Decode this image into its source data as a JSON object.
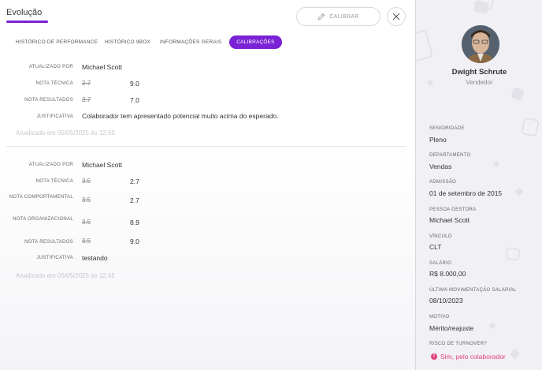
{
  "header": {
    "title": "Evolução",
    "calibrar_label": "CALIBRAR"
  },
  "tabs": [
    {
      "label": "HISTÓRICO DE PERFORMANCE",
      "active": false
    },
    {
      "label": "HISTÓRICO 9BOX",
      "active": false
    },
    {
      "label": "INFORMAÇÕES GERAIS",
      "active": false
    },
    {
      "label": "CALIBRAÇÕES",
      "active": true
    }
  ],
  "calibrations": [
    {
      "updated_by_label": "ATUALIZADO POR",
      "updated_by": "Michael Scott",
      "grades": [
        {
          "label": "NOTA TÉCNICA",
          "old": "2.7",
          "new": "9.0"
        },
        {
          "label": "NOTA RESULTADOS",
          "old": "2.7",
          "new": "7.0"
        }
      ],
      "justification_label": "JUSTIFICATIVA",
      "justification": "Colaborador tem apresentado potencial muito acima do esperado.",
      "updated_at": "Atualizado em 05/05/2025 às 12:50"
    },
    {
      "updated_by_label": "ATUALIZADO POR",
      "updated_by": "Michael Scott",
      "grades": [
        {
          "label": "NOTA TÉCNICA",
          "old": "3.5",
          "new": "2.7"
        },
        {
          "label": "NOTA COMPORTAMENTAL",
          "old": "3.5",
          "new": "2.7"
        },
        {
          "label": "NOTA ORGANIZACIONAL",
          "old": "3.5",
          "new": "8.9"
        },
        {
          "label": "NOTA RESULTADOS",
          "old": "3.5",
          "new": "9.0"
        }
      ],
      "justification_label": "JUSTIFICATIVA",
      "justification": "testando",
      "updated_at": "Atualizado em 05/05/2025 às 12:45"
    }
  ],
  "profile": {
    "name": "Dwight Schrute",
    "role": "Vendedor",
    "fields": [
      {
        "label": "SENIORIDADE",
        "value": "Pleno"
      },
      {
        "label": "DEPARTAMENTO",
        "value": "Vendas"
      },
      {
        "label": "ADMISSÃO",
        "value": "01 de setembro de 2015"
      },
      {
        "label": "PESSOA GESTORA",
        "value": "Michael Scott"
      },
      {
        "label": "VÍNCULO",
        "value": "CLT"
      },
      {
        "label": "SALÁRIO",
        "value": "R$ 8.000,00"
      },
      {
        "label": "ÚLTIMA MOVIMENTAÇÃO SALARIAL",
        "value": "08/10/2023"
      },
      {
        "label": "MOTIVO",
        "value": "Mérito/reajuste"
      }
    ],
    "turnover_label": "RISCO DE TURNOVER?",
    "turnover_value": "Sim, pelo colaborador",
    "turnover_icon": "!"
  },
  "colors": {
    "accent": "#7a22d6",
    "alert": "#e0457a"
  }
}
